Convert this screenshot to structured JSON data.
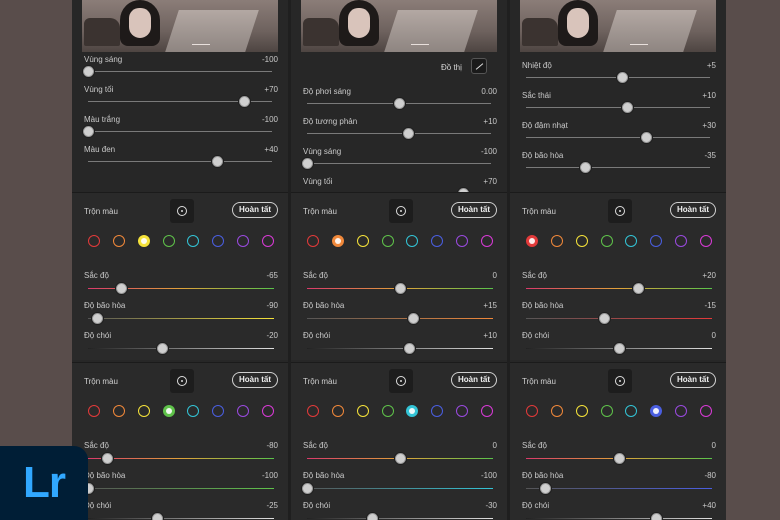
{
  "logo": {
    "text": "Lr"
  },
  "graph_button": {
    "label": "Đồ thị"
  },
  "panels_top": [
    {
      "sliders": [
        {
          "label": "Vùng sáng",
          "value": "-100",
          "fraction": 0.0
        },
        {
          "label": "Vùng tối",
          "value": "+70",
          "fraction": 0.85
        },
        {
          "label": "Màu trắng",
          "value": "-100",
          "fraction": 0.0
        },
        {
          "label": "Màu đen",
          "value": "+40",
          "fraction": 0.7
        }
      ]
    },
    {
      "sliders": [
        {
          "label": "Độ phơi sáng",
          "value": "0.00",
          "fraction": 0.5
        },
        {
          "label": "Độ tương phản",
          "value": "+10",
          "fraction": 0.55
        },
        {
          "label": "Vùng sáng",
          "value": "-100",
          "fraction": 0.0
        },
        {
          "label": "Vùng tối",
          "value": "+70",
          "fraction": 0.85
        }
      ]
    },
    {
      "sliders": [
        {
          "label": "Nhiệt độ",
          "value": "+5",
          "fraction": 0.52
        },
        {
          "label": "Sắc thái",
          "value": "+10",
          "fraction": 0.55
        },
        {
          "label": "Độ đậm nhạt",
          "value": "+30",
          "fraction": 0.65
        },
        {
          "label": "Độ bão hòa",
          "value": "-35",
          "fraction": 0.32
        }
      ]
    }
  ],
  "mixers": [
    {
      "title": "Trộn màu",
      "done_label": "Hoàn tất",
      "selected": 2,
      "sliders": [
        {
          "label": "Sắc độ",
          "value": "-65",
          "fraction": 0.18
        },
        {
          "label": "Độ bão hòa",
          "value": "-90",
          "fraction": 0.05
        },
        {
          "label": "Độ chói",
          "value": "-20",
          "fraction": 0.4
        }
      ]
    },
    {
      "title": "Trộn màu",
      "done_label": "Hoàn tất",
      "selected": 1,
      "sliders": [
        {
          "label": "Sắc độ",
          "value": "0",
          "fraction": 0.5
        },
        {
          "label": "Độ bão hòa",
          "value": "+15",
          "fraction": 0.57
        },
        {
          "label": "Độ chói",
          "value": "+10",
          "fraction": 0.55
        }
      ]
    },
    {
      "title": "Trộn màu",
      "done_label": "Hoàn tất",
      "selected": 0,
      "sliders": [
        {
          "label": "Sắc độ",
          "value": "+20",
          "fraction": 0.6
        },
        {
          "label": "Độ bão hòa",
          "value": "-15",
          "fraction": 0.42
        },
        {
          "label": "Độ chói",
          "value": "0",
          "fraction": 0.5
        }
      ]
    },
    {
      "title": "Trộn màu",
      "done_label": "Hoàn tất",
      "selected": 3,
      "sliders": [
        {
          "label": "Sắc độ",
          "value": "-80",
          "fraction": 0.1
        },
        {
          "label": "Độ bão hòa",
          "value": "-100",
          "fraction": 0.0
        },
        {
          "label": "Độ chói",
          "value": "-25",
          "fraction": 0.37
        }
      ]
    },
    {
      "title": "Trộn màu",
      "done_label": "Hoàn tất",
      "selected": 4,
      "sliders": [
        {
          "label": "Sắc độ",
          "value": "0",
          "fraction": 0.5
        },
        {
          "label": "Độ bão hòa",
          "value": "-100",
          "fraction": 0.0
        },
        {
          "label": "Độ chói",
          "value": "-30",
          "fraction": 0.35
        }
      ]
    },
    {
      "title": "Trộn màu",
      "done_label": "Hoàn tất",
      "selected": 5,
      "sliders": [
        {
          "label": "Sắc độ",
          "value": "0",
          "fraction": 0.5
        },
        {
          "label": "Độ bão hòa",
          "value": "-80",
          "fraction": 0.1
        },
        {
          "label": "Độ chói",
          "value": "+40",
          "fraction": 0.7
        }
      ]
    }
  ],
  "color_swatches": [
    "#e23a3a",
    "#f0883a",
    "#f5e23a",
    "#5fc24a",
    "#33c4d6",
    "#4a5ee0",
    "#9a4ae0",
    "#d83ad6"
  ],
  "slider_gradients": {
    "hue": [
      "#d93a6a",
      "#e0a23a",
      "#5ac24a"
    ],
    "sat": [
      "#555555",
      "#e0a23a"
    ],
    "lum": [
      "#222222",
      "#e0e0e0"
    ]
  }
}
